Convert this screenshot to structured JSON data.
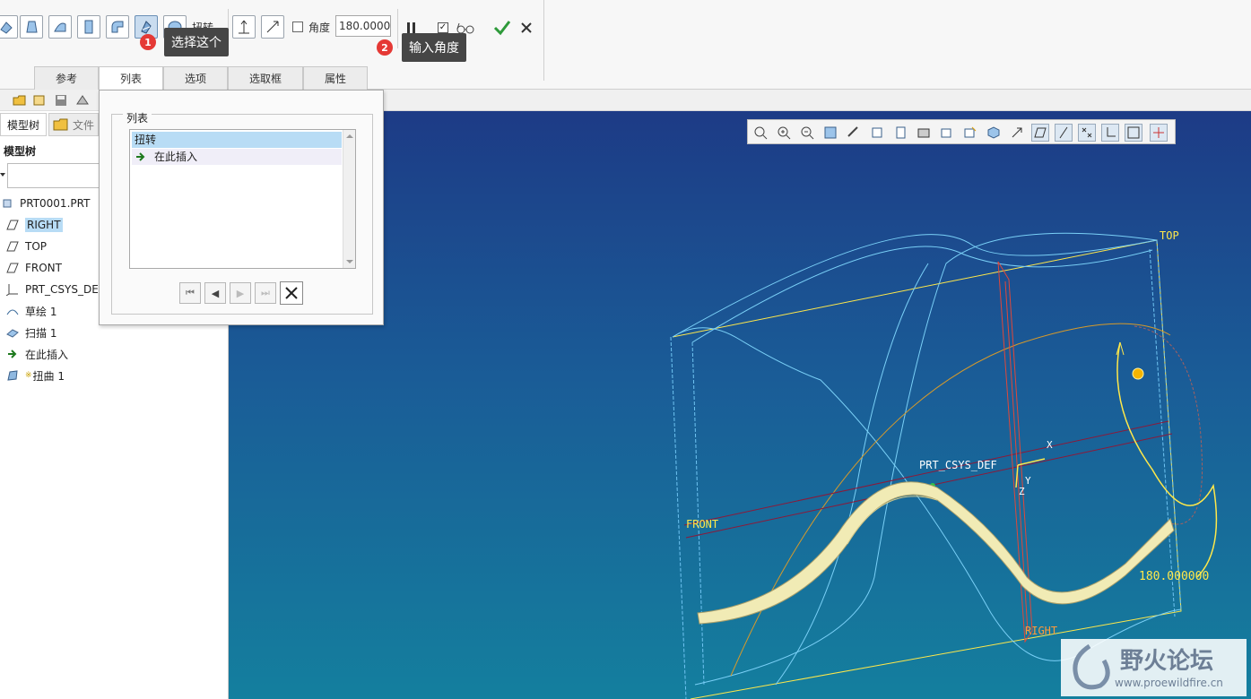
{
  "ribbon": {
    "twist_label": "扭转",
    "angle_label": "角度",
    "angle_value": "180.0000",
    "subtabs": [
      "参考",
      "列表",
      "选项",
      "选取框",
      "属性"
    ],
    "selected_subtab": "列表"
  },
  "callouts": {
    "one": {
      "badge": "1",
      "text": "选择这个"
    },
    "two": {
      "badge": "2",
      "text": "输入角度"
    }
  },
  "left_panel": {
    "tabs": [
      "模型树",
      "文件"
    ],
    "header": "模型树",
    "filter_value": "",
    "items": [
      {
        "label": "PRT0001.PRT",
        "icon": "part-icon"
      },
      {
        "label": "RIGHT",
        "icon": "datum-plane-icon"
      },
      {
        "label": "TOP",
        "icon": "datum-plane-icon"
      },
      {
        "label": "FRONT",
        "icon": "datum-plane-icon"
      },
      {
        "label": "PRT_CSYS_DEF",
        "icon": "csys-icon"
      },
      {
        "label": "草绘 1",
        "icon": "sketch-icon"
      },
      {
        "label": "扫描 1",
        "icon": "sweep-icon"
      },
      {
        "label": "在此插入",
        "icon": "insert-arrow-icon"
      },
      {
        "label": "扭曲 1",
        "marker": "※",
        "icon": "warp-icon"
      }
    ]
  },
  "list_popup": {
    "group_title": "列表",
    "items": [
      "扭转",
      "在此插入"
    ],
    "selected_item": "扭转"
  },
  "viewport": {
    "labels": {
      "top": "TOP",
      "front": "FRONT",
      "right": "RIGHT",
      "csys": "PRT_CSYS_DEF",
      "x": "X",
      "y": "Y",
      "z": "Z",
      "angle": "180.000000"
    },
    "colors": {
      "bg_top": "#1d3b86",
      "bg_bottom": "#147f9e",
      "datum": "#ffe84a",
      "solid": "#f1ebb5"
    }
  },
  "watermark": {
    "text": "野火论坛",
    "url": "www.proewildfire.cn"
  }
}
